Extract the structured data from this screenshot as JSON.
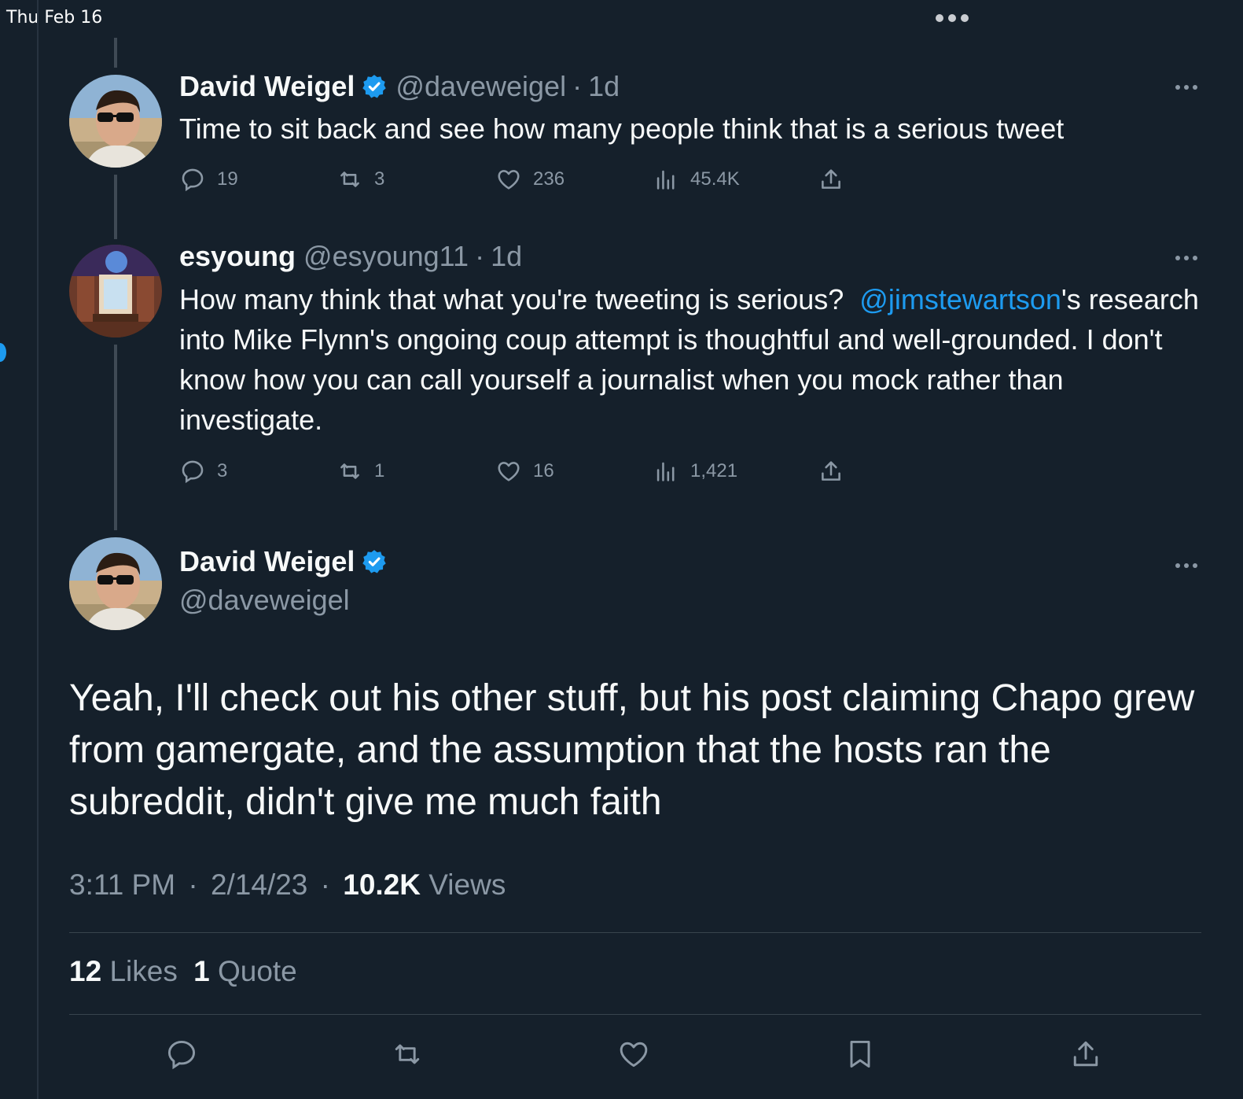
{
  "status_bar": {
    "date": "Thu Feb 16"
  },
  "colors": {
    "background": "#15202b",
    "text_primary": "#f7f9f9",
    "text_secondary": "#8b98a5",
    "accent": "#1d9bf0",
    "divider": "#38444d"
  },
  "tweets": [
    {
      "name": "David Weigel",
      "verified": true,
      "handle": "@daveweigel",
      "separator": "·",
      "age": "1d",
      "text": "Time to sit back and see how many people think that is a serious tweet",
      "replies": "19",
      "retweets": "3",
      "likes": "236",
      "views": "45.4K",
      "avatar_icon": "avatar-man-sunglasses"
    },
    {
      "name": "esyoung",
      "verified": false,
      "handle": "@esyoung11",
      "separator": "·",
      "age": "1d",
      "text_before_mention": "How many think that what you're tweeting is serious?  ",
      "mention": "@jimstewartson",
      "text_after_mention": "'s research into Mike Flynn's ongoing coup attempt is thoughtful and well-grounded. I don't know how you can call yourself a journalist when you mock rather than investigate.",
      "replies": "3",
      "retweets": "1",
      "likes": "16",
      "views": "1,421",
      "avatar_icon": "avatar-room-interior"
    }
  ],
  "main_tweet": {
    "name": "David Weigel",
    "verified": true,
    "handle": "@daveweigel",
    "text": "Yeah, I'll check out his other stuff, but his post claiming Chapo grew from gamergate, and the assumption that the hosts ran the subreddit, didn't give me much faith",
    "time": "3:11 PM",
    "date": "2/14/23",
    "separator": "·",
    "views_count": "10.2K",
    "views_label": "Views",
    "likes_count": "12",
    "likes_label": "Likes",
    "quotes_count": "1",
    "quotes_label": "Quote"
  },
  "bottom_actions": [
    "reply-icon",
    "retweet-icon",
    "like-icon",
    "bookmark-icon",
    "share-icon"
  ]
}
